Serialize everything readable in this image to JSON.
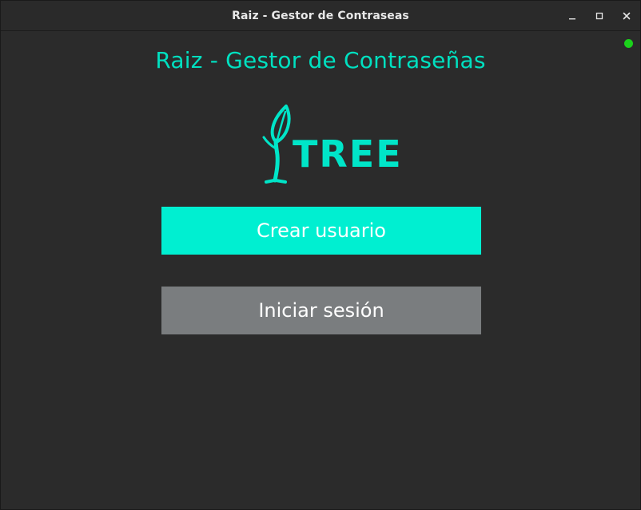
{
  "window": {
    "title": "Raiz - Gestor de Contraseas",
    "controls": {
      "minimize_icon": "minimize-icon",
      "maximize_icon": "maximize-icon",
      "close_icon": "close-icon"
    }
  },
  "status": {
    "indicator_color": "#1bd11b"
  },
  "main": {
    "title": "Raiz - Gestor de Contraseñas",
    "logo": {
      "icon": "sprout-tree-icon",
      "text": "TREE"
    },
    "buttons": {
      "create_user": "Crear usuario",
      "login": "Iniciar sesión"
    }
  },
  "colors": {
    "background": "#2b2b2b",
    "accent": "#00e0c0",
    "primary_button": "#00efd1",
    "secondary_button": "#7a7d7f"
  }
}
